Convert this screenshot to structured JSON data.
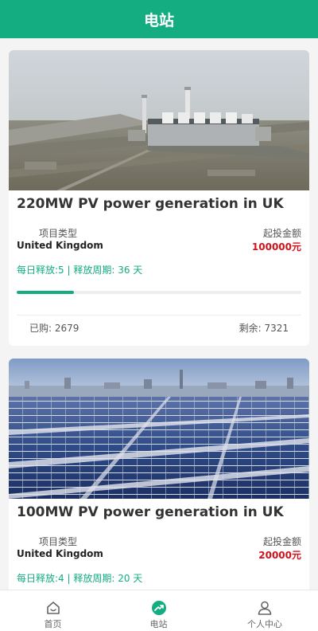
{
  "header": {
    "title": "电站"
  },
  "stations": [
    {
      "title": "220MW PV power generation in UK",
      "type_label": "项目类型",
      "type_value": "United Kingdom",
      "min_label": "起投金额",
      "min_value": "100000元",
      "release_text": "每日释放:5 | 释放周期: 36 天",
      "progress": 0.2,
      "bought_text": "已购: 2679",
      "remain_text": "剩余: 7321"
    },
    {
      "title": "100MW PV power generation in UK",
      "type_label": "项目类型",
      "type_value": "United Kingdom",
      "min_label": "起投金额",
      "min_value": "20000元",
      "release_text": "每日释放:4 | 释放周期: 20 天"
    }
  ],
  "tabbar": {
    "home": "首页",
    "station": "电站",
    "profile": "个人中心"
  },
  "colors": {
    "accent": "#14ad82",
    "price": "#d0121b"
  }
}
